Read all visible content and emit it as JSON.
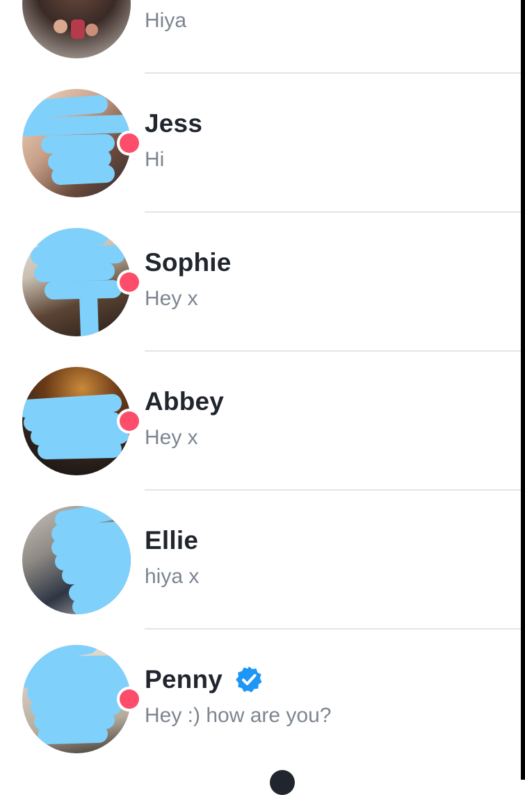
{
  "colors": {
    "name_text": "#21262e",
    "preview_text": "#7c8591",
    "unread_dot": "#fd4d6b",
    "verified_badge": "#1d96f5",
    "divider": "#e2e4e8",
    "redaction_scribble": "#7fd0fb"
  },
  "matches": [
    {
      "name": "",
      "preview": "Hiya",
      "unread": false,
      "verified": false
    },
    {
      "name": "Jess",
      "preview": "Hi",
      "unread": true,
      "verified": false
    },
    {
      "name": "Sophie",
      "preview": "Hey x",
      "unread": true,
      "verified": false
    },
    {
      "name": "Abbey",
      "preview": "Hey x",
      "unread": true,
      "verified": false
    },
    {
      "name": "Ellie",
      "preview": "hiya x",
      "unread": false,
      "verified": false
    },
    {
      "name": "Penny",
      "preview": "Hey :) how are you?",
      "unread": true,
      "verified": true
    }
  ],
  "icons": {
    "verified": "verified-check-icon",
    "avatar_redaction": "redaction-scribble"
  }
}
